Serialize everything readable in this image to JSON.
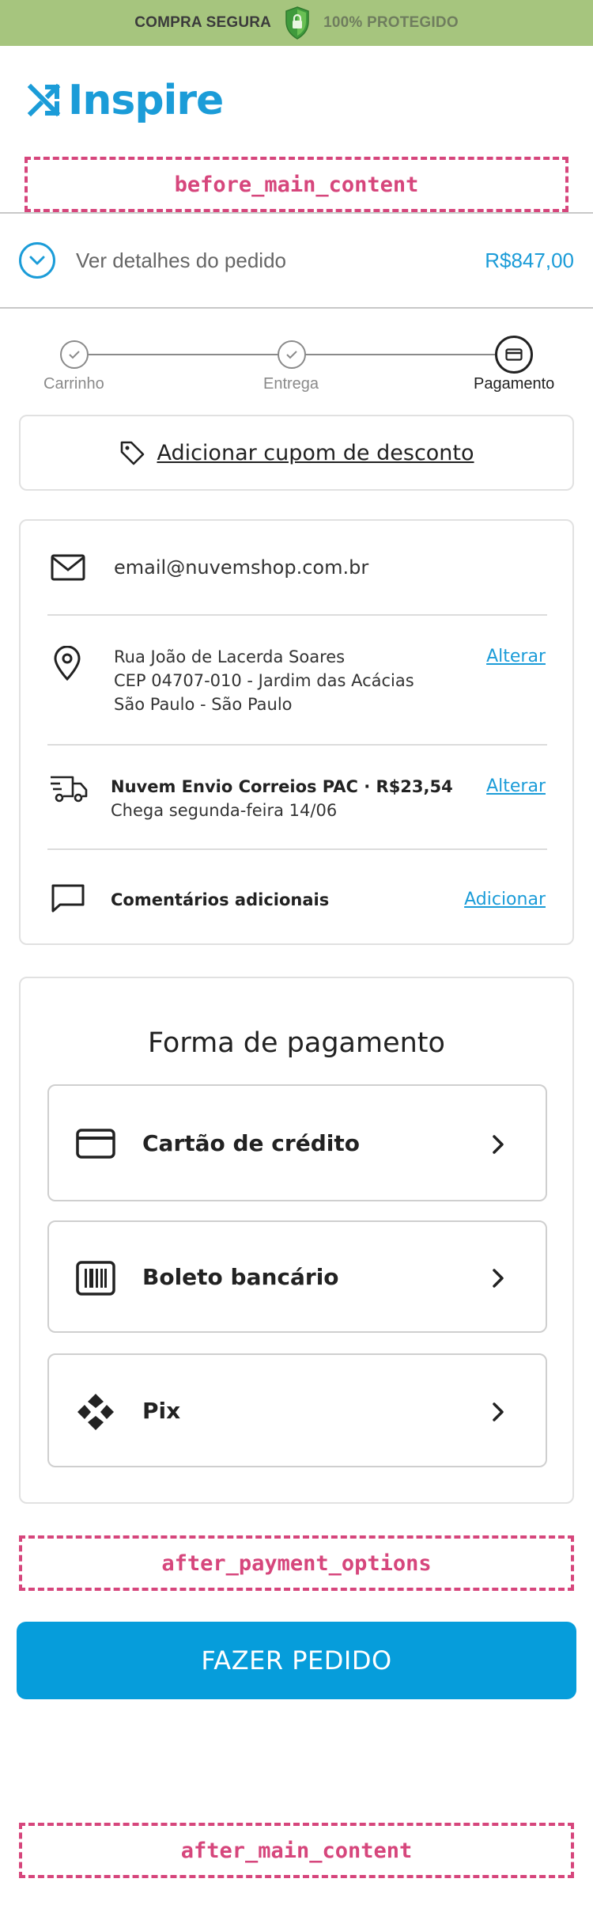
{
  "top_bar": {
    "left_text": "COMPRA SEGURA",
    "right_text": "100% PROTEGIDO"
  },
  "brand": {
    "name": "Inspire",
    "color": "#1b9cd8"
  },
  "placeholders": {
    "before_main": "before_main_content",
    "after_payment": "after_payment_options",
    "after_main": "after_main_content"
  },
  "order_summary": {
    "label": "Ver detalhes do pedido",
    "total": "R$847,00"
  },
  "stepper": {
    "steps": [
      {
        "label": "Carrinho",
        "state": "done"
      },
      {
        "label": "Entrega",
        "state": "done"
      },
      {
        "label": "Pagamento",
        "state": "current"
      }
    ]
  },
  "coupon": {
    "label": "Adicionar cupom de desconto"
  },
  "customer": {
    "email": "email@nuvemshop.com.br",
    "address": {
      "line1": "Rua João de Lacerda Soares",
      "line2": "CEP 04707-010 - Jardim das Acácias",
      "line3": "São Paulo - São Paulo",
      "action": "Alterar"
    },
    "shipping": {
      "method": "Nuvem Envio Correios PAC · R$23,54",
      "eta": "Chega segunda-feira 14/06",
      "action": "Alterar"
    },
    "comments": {
      "label": "Comentários adicionais",
      "action": "Adicionar"
    }
  },
  "payment": {
    "title": "Forma de pagamento",
    "options": [
      {
        "label": "Cartão de crédito",
        "icon": "credit-card-icon"
      },
      {
        "label": "Boleto bancário",
        "icon": "barcode-icon"
      },
      {
        "label": "Pix",
        "icon": "pix-icon"
      }
    ]
  },
  "cta": {
    "label": "FAZER PEDIDO",
    "color": "#069ddb"
  },
  "colors": {
    "top_bar": "#a6c57e",
    "accent": "#1b9cd8",
    "placeholder": "#d6467c"
  }
}
